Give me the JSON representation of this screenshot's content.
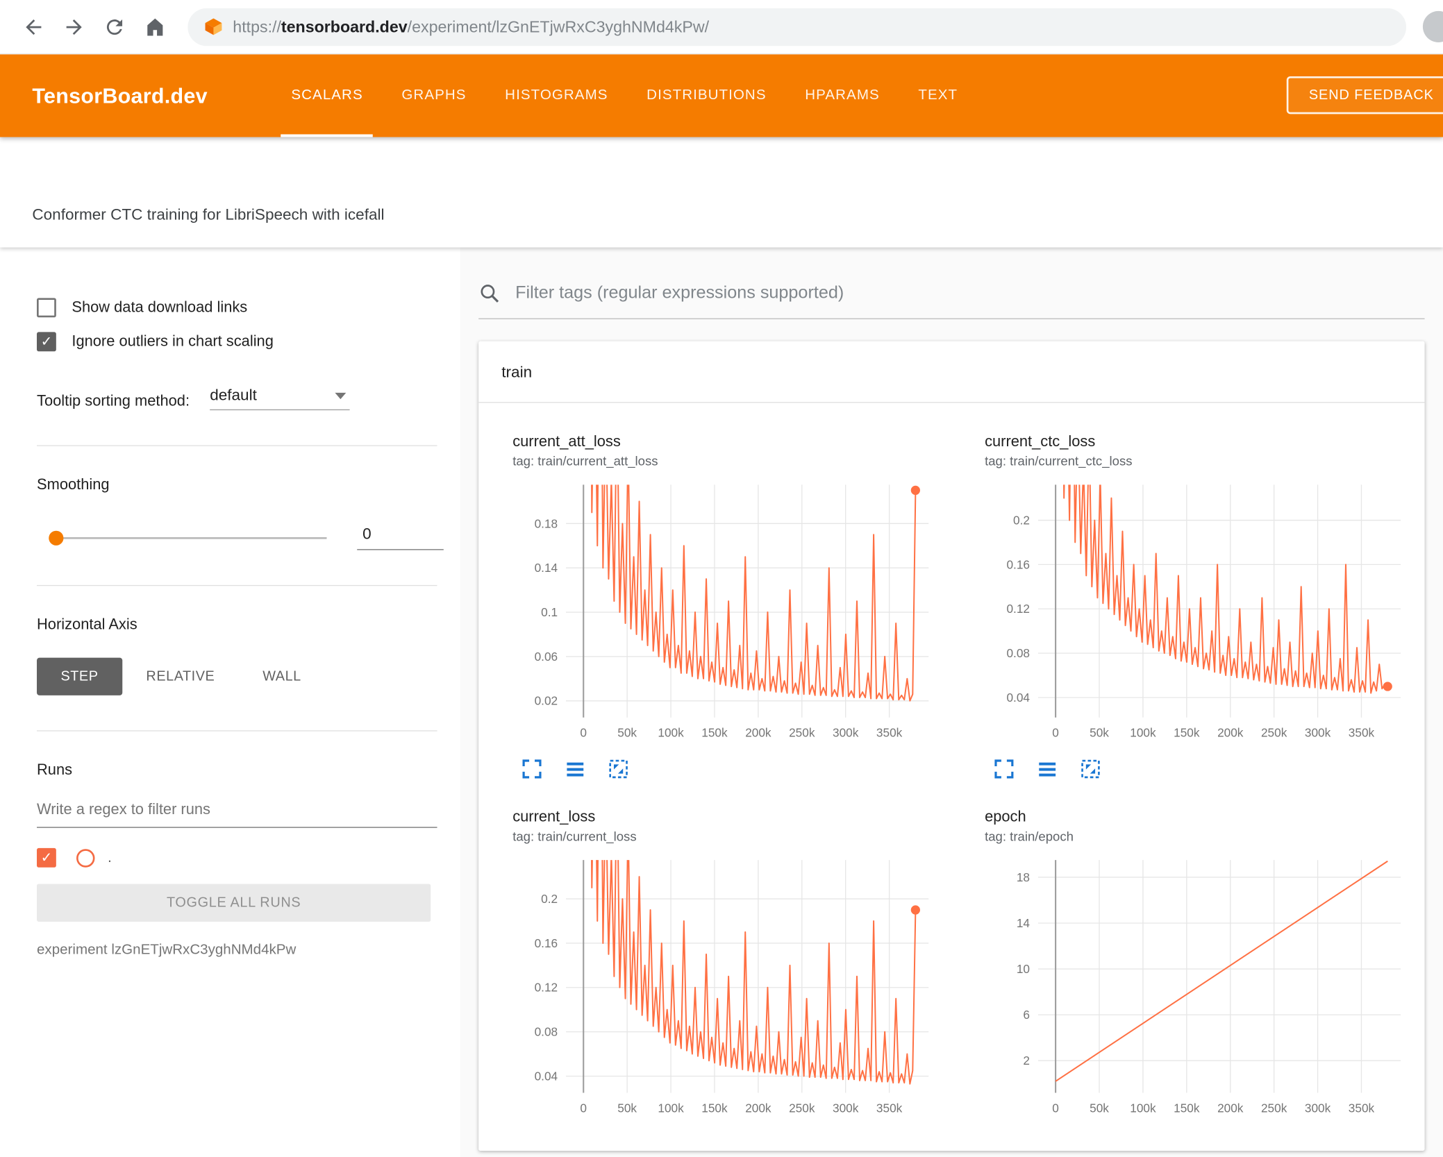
{
  "browser": {
    "url_protocol": "https://",
    "url_domain": "tensorboard.dev",
    "url_path": "/experiment/lzGnETjwRxC3yghNMd4kPw/"
  },
  "header": {
    "brand": "TensorBoard.dev",
    "tabs": [
      {
        "label": "SCALARS",
        "active": true
      },
      {
        "label": "GRAPHS",
        "active": false
      },
      {
        "label": "HISTOGRAMS",
        "active": false
      },
      {
        "label": "DISTRIBUTIONS",
        "active": false
      },
      {
        "label": "HPARAMS",
        "active": false
      },
      {
        "label": "TEXT",
        "active": false
      }
    ],
    "feedback_label": "SEND FEEDBACK"
  },
  "subheader": {
    "title": "Conformer CTC training for LibriSpeech with icefall"
  },
  "sidebar": {
    "show_download": {
      "label": "Show data download links",
      "checked": false
    },
    "ignore_outliers": {
      "label": "Ignore outliers in chart scaling",
      "checked": true
    },
    "tooltip_sort": {
      "label": "Tooltip sorting method:",
      "value": "default"
    },
    "smoothing": {
      "label": "Smoothing",
      "value": "0"
    },
    "horizontal_axis": {
      "label": "Horizontal Axis",
      "options": [
        "STEP",
        "RELATIVE",
        "WALL"
      ],
      "selected": "STEP"
    },
    "runs": {
      "label": "Runs",
      "filter_placeholder": "Write a regex to filter runs",
      "run_label": ".",
      "run_checked": true,
      "toggle_all_label": "TOGGLE ALL RUNS",
      "experiment_caption": "experiment lzGnETjwRxC3yghNMd4kPw"
    }
  },
  "main": {
    "filter_placeholder": "Filter tags (regular expressions supported)",
    "section_label": "train"
  },
  "icons": {
    "search": "magnifier",
    "chart_tools": [
      "expand-chart",
      "view-run-data",
      "fit-domain-to-data"
    ]
  },
  "colors": {
    "header_orange": "#f57c00",
    "line_orange": "#ff7043",
    "icon_blue": "#1976d2",
    "grid_gray": "#e6e6e6",
    "zero_line_gray": "#9e9e9e"
  },
  "chart_data": [
    {
      "type": "line",
      "title": "current_att_loss",
      "tag": "tag: train/current_att_loss",
      "xlim": [
        -20000,
        395000
      ],
      "x_max": 380000,
      "x_ticks": [
        {
          "v": 0,
          "label": "0"
        },
        {
          "v": 50000,
          "label": "50k"
        },
        {
          "v": 100000,
          "label": "100k"
        },
        {
          "v": 150000,
          "label": "150k"
        },
        {
          "v": 200000,
          "label": "200k"
        },
        {
          "v": 250000,
          "label": "250k"
        },
        {
          "v": 300000,
          "label": "300k"
        },
        {
          "v": 350000,
          "label": "350k"
        }
      ],
      "ylim": [
        0.005,
        0.215
      ],
      "y_ticks": [
        {
          "v": 0.02,
          "label": "0.02"
        },
        {
          "v": 0.06,
          "label": "0.06"
        },
        {
          "v": 0.1,
          "label": "0.1"
        },
        {
          "v": 0.14,
          "label": "0.14"
        },
        {
          "v": 0.18,
          "label": "0.18"
        }
      ],
      "end_dot": true,
      "values": [
        0.5,
        0.22,
        0.6,
        0.19,
        0.35,
        0.16,
        0.45,
        0.14,
        0.28,
        0.13,
        0.22,
        0.11,
        0.3,
        0.1,
        0.18,
        0.09,
        0.25,
        0.085,
        0.15,
        0.08,
        0.2,
        0.075,
        0.12,
        0.07,
        0.17,
        0.065,
        0.1,
        0.06,
        0.14,
        0.055,
        0.08,
        0.05,
        0.12,
        0.05,
        0.07,
        0.045,
        0.16,
        0.045,
        0.065,
        0.042,
        0.1,
        0.04,
        0.06,
        0.04,
        0.13,
        0.038,
        0.055,
        0.037,
        0.09,
        0.035,
        0.05,
        0.034,
        0.11,
        0.033,
        0.048,
        0.032,
        0.07,
        0.031,
        0.15,
        0.03,
        0.045,
        0.03,
        0.065,
        0.03,
        0.04,
        0.029,
        0.1,
        0.029,
        0.042,
        0.028,
        0.06,
        0.028,
        0.038,
        0.027,
        0.12,
        0.027,
        0.036,
        0.026,
        0.055,
        0.026,
        0.09,
        0.026,
        0.034,
        0.025,
        0.07,
        0.025,
        0.032,
        0.025,
        0.14,
        0.024,
        0.03,
        0.024,
        0.05,
        0.024,
        0.08,
        0.024,
        0.029,
        0.023,
        0.11,
        0.023,
        0.028,
        0.023,
        0.045,
        0.022,
        0.17,
        0.022,
        0.027,
        0.022,
        0.06,
        0.022,
        0.026,
        0.021,
        0.09,
        0.021,
        0.025,
        0.021,
        0.04,
        0.02,
        0.026,
        0.21
      ]
    },
    {
      "type": "line",
      "title": "current_ctc_loss",
      "tag": "tag: train/current_ctc_loss",
      "xlim": [
        -20000,
        395000
      ],
      "x_max": 380000,
      "x_ticks": [
        {
          "v": 0,
          "label": "0"
        },
        {
          "v": 50000,
          "label": "50k"
        },
        {
          "v": 100000,
          "label": "100k"
        },
        {
          "v": 150000,
          "label": "150k"
        },
        {
          "v": 200000,
          "label": "200k"
        },
        {
          "v": 250000,
          "label": "250k"
        },
        {
          "v": 300000,
          "label": "300k"
        },
        {
          "v": 350000,
          "label": "350k"
        }
      ],
      "ylim": [
        0.022,
        0.232
      ],
      "y_ticks": [
        {
          "v": 0.04,
          "label": "0.04"
        },
        {
          "v": 0.08,
          "label": "0.08"
        },
        {
          "v": 0.12,
          "label": "0.12"
        },
        {
          "v": 0.16,
          "label": "0.16"
        },
        {
          "v": 0.2,
          "label": "0.2"
        }
      ],
      "end_dot": true,
      "values": [
        0.45,
        0.25,
        0.5,
        0.22,
        0.35,
        0.2,
        0.4,
        0.18,
        0.3,
        0.17,
        0.25,
        0.15,
        0.28,
        0.14,
        0.2,
        0.13,
        0.24,
        0.125,
        0.17,
        0.12,
        0.22,
        0.115,
        0.15,
        0.11,
        0.19,
        0.105,
        0.13,
        0.1,
        0.16,
        0.095,
        0.12,
        0.09,
        0.15,
        0.088,
        0.11,
        0.085,
        0.17,
        0.082,
        0.1,
        0.08,
        0.13,
        0.078,
        0.095,
        0.075,
        0.15,
        0.073,
        0.09,
        0.072,
        0.12,
        0.07,
        0.085,
        0.068,
        0.13,
        0.066,
        0.08,
        0.065,
        0.1,
        0.063,
        0.16,
        0.062,
        0.078,
        0.06,
        0.095,
        0.06,
        0.075,
        0.058,
        0.12,
        0.058,
        0.072,
        0.057,
        0.09,
        0.056,
        0.07,
        0.055,
        0.13,
        0.054,
        0.068,
        0.053,
        0.085,
        0.052,
        0.11,
        0.052,
        0.066,
        0.051,
        0.09,
        0.05,
        0.064,
        0.05,
        0.14,
        0.05,
        0.062,
        0.049,
        0.08,
        0.049,
        0.1,
        0.048,
        0.06,
        0.048,
        0.12,
        0.047,
        0.058,
        0.047,
        0.075,
        0.046,
        0.16,
        0.046,
        0.056,
        0.045,
        0.085,
        0.045,
        0.055,
        0.045,
        0.11,
        0.044,
        0.054,
        0.046,
        0.07,
        0.048,
        0.052,
        0.05
      ]
    },
    {
      "type": "line",
      "title": "current_loss",
      "tag": "tag: train/current_loss",
      "xlim": [
        -20000,
        395000
      ],
      "x_max": 380000,
      "x_ticks": [
        {
          "v": 0,
          "label": "0"
        },
        {
          "v": 50000,
          "label": "50k"
        },
        {
          "v": 100000,
          "label": "100k"
        },
        {
          "v": 150000,
          "label": "150k"
        },
        {
          "v": 200000,
          "label": "200k"
        },
        {
          "v": 250000,
          "label": "250k"
        },
        {
          "v": 300000,
          "label": "300k"
        },
        {
          "v": 350000,
          "label": "350k"
        }
      ],
      "ylim": [
        0.025,
        0.235
      ],
      "y_ticks": [
        {
          "v": 0.04,
          "label": "0.04"
        },
        {
          "v": 0.08,
          "label": "0.08"
        },
        {
          "v": 0.12,
          "label": "0.12"
        },
        {
          "v": 0.16,
          "label": "0.16"
        },
        {
          "v": 0.2,
          "label": "0.2"
        }
      ],
      "end_dot": true,
      "values": [
        0.5,
        0.24,
        0.55,
        0.21,
        0.38,
        0.18,
        0.48,
        0.16,
        0.3,
        0.15,
        0.24,
        0.13,
        0.32,
        0.12,
        0.2,
        0.11,
        0.27,
        0.105,
        0.17,
        0.1,
        0.22,
        0.095,
        0.14,
        0.09,
        0.19,
        0.085,
        0.12,
        0.08,
        0.16,
        0.075,
        0.1,
        0.07,
        0.14,
        0.068,
        0.09,
        0.065,
        0.18,
        0.063,
        0.085,
        0.06,
        0.12,
        0.058,
        0.08,
        0.056,
        0.15,
        0.054,
        0.075,
        0.052,
        0.11,
        0.05,
        0.07,
        0.049,
        0.13,
        0.048,
        0.065,
        0.047,
        0.09,
        0.046,
        0.17,
        0.045,
        0.062,
        0.044,
        0.085,
        0.044,
        0.06,
        0.043,
        0.12,
        0.043,
        0.058,
        0.042,
        0.08,
        0.042,
        0.055,
        0.041,
        0.14,
        0.041,
        0.053,
        0.04,
        0.075,
        0.04,
        0.11,
        0.039,
        0.052,
        0.039,
        0.09,
        0.039,
        0.05,
        0.038,
        0.16,
        0.038,
        0.048,
        0.038,
        0.07,
        0.037,
        0.1,
        0.037,
        0.046,
        0.037,
        0.13,
        0.036,
        0.045,
        0.036,
        0.065,
        0.036,
        0.18,
        0.035,
        0.044,
        0.035,
        0.08,
        0.035,
        0.043,
        0.034,
        0.11,
        0.034,
        0.042,
        0.034,
        0.06,
        0.033,
        0.045,
        0.19
      ]
    },
    {
      "type": "line",
      "title": "epoch",
      "tag": "tag: train/epoch",
      "xlim": [
        -20000,
        395000
      ],
      "x_max": 380000,
      "x_ticks": [
        {
          "v": 0,
          "label": "0"
        },
        {
          "v": 50000,
          "label": "50k"
        },
        {
          "v": 100000,
          "label": "100k"
        },
        {
          "v": 150000,
          "label": "150k"
        },
        {
          "v": 200000,
          "label": "200k"
        },
        {
          "v": 250000,
          "label": "250k"
        },
        {
          "v": 300000,
          "label": "300k"
        },
        {
          "v": 350000,
          "label": "350k"
        }
      ],
      "ylim": [
        -0.8,
        19.5
      ],
      "y_ticks": [
        {
          "v": 2,
          "label": "2"
        },
        {
          "v": 6,
          "label": "6"
        },
        {
          "v": 10,
          "label": "10"
        },
        {
          "v": 14,
          "label": "14"
        },
        {
          "v": 18,
          "label": "18"
        }
      ],
      "end_dot": false,
      "points": [
        [
          0,
          0.2
        ],
        [
          380000,
          19.4
        ]
      ]
    }
  ]
}
